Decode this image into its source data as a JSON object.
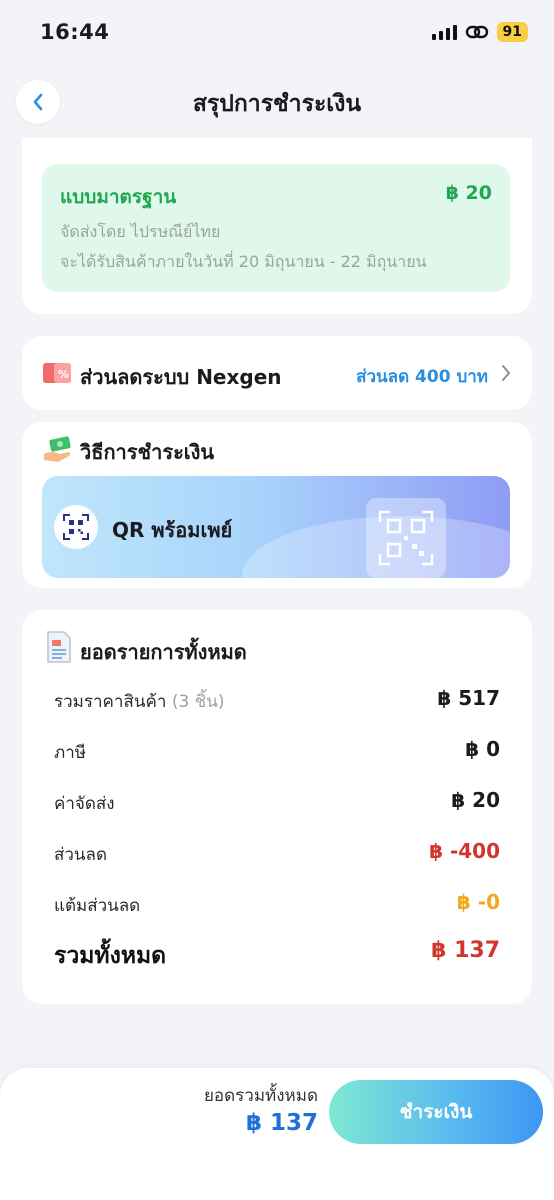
{
  "status_bar": {
    "time": "16:44",
    "battery": "91"
  },
  "header": {
    "title": "สรุปการชำระเงิน"
  },
  "shipping": {
    "name": "แบบมาตรฐาน",
    "price": "฿ 20",
    "carrier": "จัดส่งโดย ไปรษณีย์ไทย",
    "eta": "จะได้รับสินค้าภายในวันที่ 20 มิถุนายน - 22 มิถุนายน"
  },
  "discount": {
    "label": "ส่วนลดระบบ Nexgen",
    "value": "ส่วนลด 400 บาท"
  },
  "payment": {
    "title": "วิธีการชำระเงิน",
    "method": "QR พร้อมเพย์"
  },
  "summary": {
    "title": "ยอดรายการทั้งหมด",
    "rows": [
      {
        "label": "รวมราคาสินค้า",
        "sub": "(3 ชิ้น)",
        "value": "฿ 517"
      },
      {
        "label": "ภาษี",
        "value": "฿ 0"
      },
      {
        "label": "ค่าจัดส่ง",
        "value": "฿ 20"
      },
      {
        "label": "ส่วนลด",
        "value": "฿ -400"
      },
      {
        "label": "แต้มส่วนลด",
        "value": "฿ -0"
      }
    ],
    "total": {
      "label": "รวมทั้งหมด",
      "value": "฿ 137"
    }
  },
  "footer": {
    "total_label": "ยอดรวมทั้งหมด",
    "total_value": "฿ 137",
    "pay_button": "ชำระเงิน"
  },
  "colors": {
    "green": "#1fa84f",
    "blue": "#2a8ee0",
    "red": "#d0362b",
    "orange": "#f2a81e",
    "total_blue": "#1f6fd6"
  }
}
